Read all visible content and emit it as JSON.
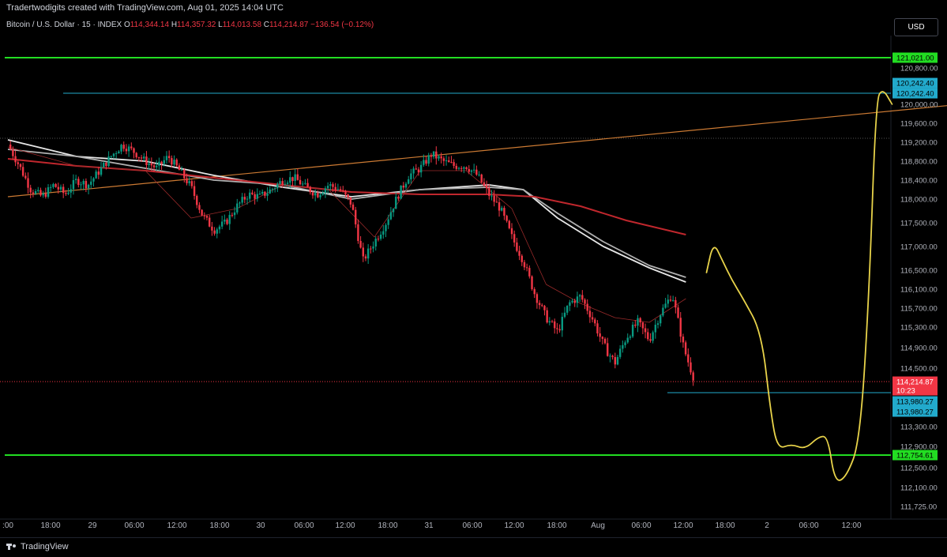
{
  "header": {
    "attribution": "Tradertwodigits created with TradingView.com, Aug 01, 2025 14:04 UTC"
  },
  "legend": {
    "symbol": "Bitcoin / U.S. Dollar · 15 · INDEX",
    "o_label": "O",
    "o_value": "114,344.14",
    "h_label": "H",
    "h_value": "114,357.32",
    "l_label": "L",
    "l_value": "114,013.58",
    "c_label": "C",
    "c_value": "114,214.87",
    "change": "−136.54 (−0.12%)"
  },
  "currency_button": "USD",
  "footer": {
    "brand": "TradingView"
  },
  "colors": {
    "background": "#000000",
    "up_candle": "#089981",
    "down_candle": "#f23645",
    "support_resistance": "#22dd22",
    "target_line": "#22aacc",
    "trendline": "#cc7a33",
    "ma_white": "#e6e6e6",
    "ma_grey": "#b0b0b0",
    "ma_red": "#c0272d",
    "ma_thin_red": "#9a2a2a",
    "annotation": "#e8d34a"
  },
  "chart_data": {
    "type": "candlestick",
    "title": "Bitcoin / U.S. Dollar · 15 · INDEX",
    "x_tick_labels": [
      ":00",
      "18:00",
      "29",
      "06:00",
      "12:00",
      "18:00",
      "30",
      "06:00",
      "12:00",
      "18:00",
      "31",
      "06:00",
      "12:00",
      "18:00",
      "Aug",
      "06:00",
      "12:00",
      "18:00",
      "2",
      "06:00",
      "12:00"
    ],
    "y_tick_labels": [
      "120,800.00",
      "120,000.00",
      "119,600.00",
      "119,200.00",
      "118,800.00",
      "118,400.00",
      "118,000.00",
      "117,500.00",
      "117,000.00",
      "116,500.00",
      "116,100.00",
      "115,700.00",
      "115,300.00",
      "114,900.00",
      "114,500.00",
      "113,300.00",
      "112,900.00",
      "112,500.00",
      "112,100.00",
      "111,725.00"
    ],
    "y_tick_values": [
      120800,
      120000,
      119600,
      119200,
      118800,
      118400,
      118000,
      117500,
      117000,
      116500,
      116100,
      115700,
      115300,
      114900,
      114500,
      113300,
      112900,
      112500,
      112100,
      111725
    ],
    "ylim": [
      111725,
      121021
    ],
    "close_path": [
      [
        0,
        119150
      ],
      [
        0.5,
        118700
      ],
      [
        1,
        118200
      ],
      [
        1.5,
        118050
      ],
      [
        2,
        118300
      ],
      [
        2.5,
        118100
      ],
      [
        3,
        118400
      ],
      [
        3.5,
        118300
      ],
      [
        4,
        118600
      ],
      [
        4.5,
        118900
      ],
      [
        5,
        119150
      ],
      [
        5.5,
        119000
      ],
      [
        6,
        118800
      ],
      [
        6.5,
        118650
      ],
      [
        7,
        118900
      ],
      [
        7.5,
        118600
      ],
      [
        8,
        118250
      ],
      [
        8.5,
        117650
      ],
      [
        9,
        117350
      ],
      [
        9.5,
        117500
      ],
      [
        10,
        117850
      ],
      [
        10.5,
        118100
      ],
      [
        11,
        118050
      ],
      [
        11.5,
        118200
      ],
      [
        12,
        118400
      ],
      [
        12.5,
        118450
      ],
      [
        13,
        118250
      ],
      [
        13.5,
        118100
      ],
      [
        14,
        118300
      ],
      [
        14.5,
        118200
      ],
      [
        15,
        117900
      ],
      [
        15.5,
        116700
      ],
      [
        16,
        117100
      ],
      [
        16.5,
        117500
      ],
      [
        17,
        118050
      ],
      [
        17.5,
        118500
      ],
      [
        18,
        118650
      ],
      [
        18.5,
        118950
      ],
      [
        19,
        118800
      ],
      [
        19.5,
        118700
      ],
      [
        20,
        118700
      ],
      [
        20.5,
        118500
      ],
      [
        21,
        118100
      ],
      [
        21.5,
        117800
      ],
      [
        22,
        117200
      ],
      [
        22.5,
        116700
      ],
      [
        23,
        116000
      ],
      [
        23.5,
        115500
      ],
      [
        24,
        115200
      ],
      [
        24.5,
        115800
      ],
      [
        25,
        115950
      ],
      [
        25.5,
        115500
      ],
      [
        26,
        114950
      ],
      [
        26.5,
        114600
      ],
      [
        27,
        115100
      ],
      [
        27.5,
        115400
      ],
      [
        28,
        115050
      ],
      [
        28.5,
        115600
      ],
      [
        29,
        116000
      ],
      [
        29.5,
        114900
      ],
      [
        30,
        114214.87
      ]
    ],
    "current_price": "114,214.87",
    "countdown": "10:23",
    "levels": [
      {
        "label": "121,021.00",
        "value": 121021,
        "type": "horizontal",
        "color": "#22dd22"
      },
      {
        "label": "120,242.40",
        "value": 120242.4,
        "type": "horizontal",
        "color": "#22aacc"
      },
      {
        "label": "120,242.40",
        "value": 120242.4,
        "type": "price-tag",
        "color": "#22aacc"
      },
      {
        "label": "113,980.27",
        "value": 113980.27,
        "type": "horizontal",
        "color": "#22aacc"
      },
      {
        "label": "113,980.27",
        "value": 113980.27,
        "type": "price-tag",
        "color": "#22aacc"
      },
      {
        "label": "112,754.61",
        "value": 112754.61,
        "type": "horizontal",
        "color": "#22dd22"
      }
    ],
    "trendline": [
      [
        0,
        118050
      ],
      [
        41.8,
        120010
      ]
    ],
    "moving_averages": [
      {
        "name": "MA-white",
        "color": "#e6e6e6",
        "points": [
          [
            0,
            119250
          ],
          [
            3,
            118900
          ],
          [
            6,
            118800
          ],
          [
            9,
            118500
          ],
          [
            12,
            118250
          ],
          [
            15,
            118050
          ],
          [
            18,
            118200
          ],
          [
            21,
            118300
          ],
          [
            22.5,
            118200
          ],
          [
            24,
            117600
          ],
          [
            26,
            117000
          ],
          [
            28,
            116550
          ],
          [
            29.6,
            116250
          ]
        ]
      },
      {
        "name": "MA-grey",
        "color": "#b0b0b0",
        "points": [
          [
            0,
            119050
          ],
          [
            3,
            118900
          ],
          [
            6,
            118650
          ],
          [
            9,
            118400
          ],
          [
            12,
            118300
          ],
          [
            15,
            118000
          ],
          [
            18,
            118200
          ],
          [
            21,
            118250
          ],
          [
            22.5,
            118200
          ],
          [
            24,
            117700
          ],
          [
            26,
            117100
          ],
          [
            28,
            116600
          ],
          [
            29.6,
            116350
          ]
        ]
      },
      {
        "name": "MA-red",
        "color": "#c0272d",
        "points": [
          [
            0,
            118850
          ],
          [
            3,
            118700
          ],
          [
            6,
            118600
          ],
          [
            9,
            118450
          ],
          [
            12,
            118300
          ],
          [
            15,
            118150
          ],
          [
            18,
            118100
          ],
          [
            21,
            118100
          ],
          [
            23,
            118050
          ],
          [
            25,
            117850
          ],
          [
            27,
            117550
          ],
          [
            29.6,
            117250
          ]
        ]
      },
      {
        "name": "MA-thin",
        "color": "#9a2a2a",
        "points": [
          [
            0,
            119100
          ],
          [
            3,
            118700
          ],
          [
            6,
            118600
          ],
          [
            8,
            117600
          ],
          [
            10,
            117800
          ],
          [
            12,
            118300
          ],
          [
            14,
            118200
          ],
          [
            16,
            117200
          ],
          [
            18,
            118600
          ],
          [
            20,
            118600
          ],
          [
            22,
            117800
          ],
          [
            23.5,
            116200
          ],
          [
            25,
            115800
          ],
          [
            26.5,
            115500
          ],
          [
            28,
            115400
          ],
          [
            29.6,
            115900
          ]
        ]
      }
    ],
    "annotation_path": [
      [
        30.5,
        116450
      ],
      [
        30.8,
        117100
      ],
      [
        31.2,
        116700
      ],
      [
        31.6,
        116300
      ],
      [
        32.1,
        115900
      ],
      [
        32.9,
        115200
      ],
      [
        33.3,
        113600
      ],
      [
        33.6,
        112850
      ],
      [
        34.2,
        112950
      ],
      [
        34.8,
        112850
      ],
      [
        35.4,
        113100
      ],
      [
        35.8,
        113100
      ],
      [
        36.1,
        112200
      ],
      [
        36.6,
        112300
      ],
      [
        37.2,
        113000
      ],
      [
        37.6,
        116000
      ],
      [
        37.9,
        120100
      ],
      [
        38.2,
        120350
      ],
      [
        38.6,
        120000
      ]
    ],
    "grid": false,
    "legend_position": "top-left"
  }
}
